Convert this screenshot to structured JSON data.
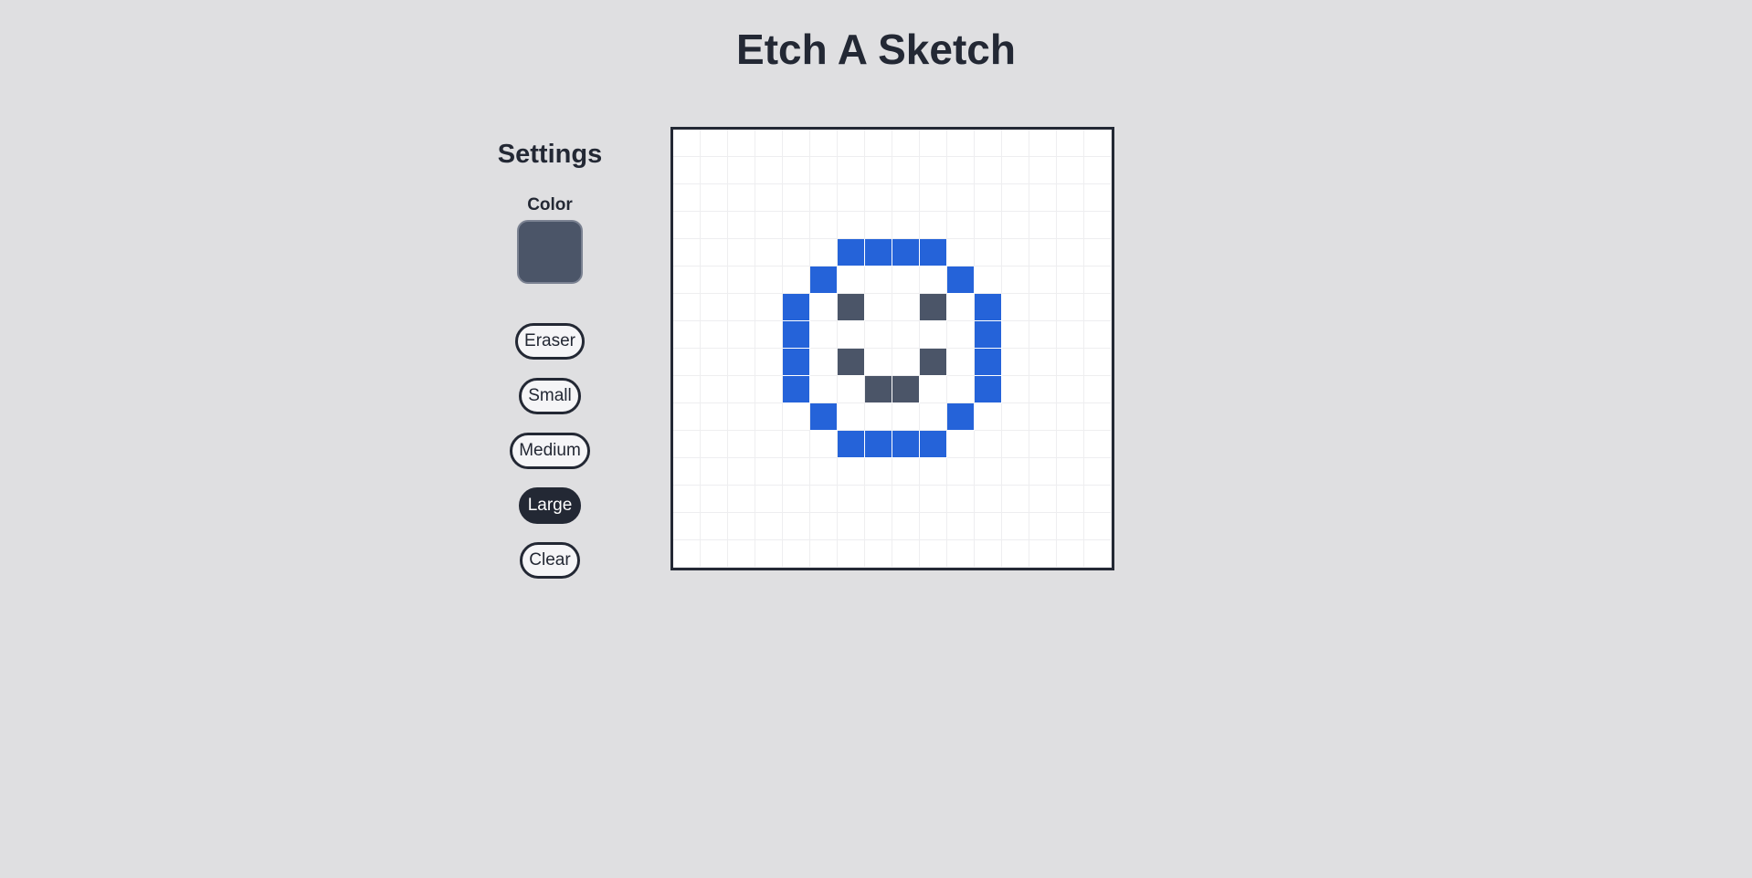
{
  "header": {
    "title": "Etch A Sketch"
  },
  "settings": {
    "title": "Settings",
    "color_label": "Color",
    "selected_color": "#4b5568",
    "buttons": [
      {
        "label": "Eraser",
        "active": false
      },
      {
        "label": "Small",
        "active": false
      },
      {
        "label": "Medium",
        "active": false
      },
      {
        "label": "Large",
        "active": true
      },
      {
        "label": "Clear",
        "active": false
      }
    ]
  },
  "board": {
    "rows": 16,
    "cols": 16,
    "empty_color": "#ffffff",
    "palette": {
      "1": "#2563d9",
      "2": "#4b5568"
    },
    "cells": [
      "0000000000000000",
      "0000000000000000",
      "0000000000000000",
      "0000000000000000",
      "0000001111000000",
      "0000010000100000",
      "0000102002010000",
      "0000100000010000",
      "0000102002010000",
      "0000100220010000",
      "0000010000100000",
      "0000001111000000",
      "0000000000000000",
      "0000000000000000",
      "0000000000000000",
      "0000000000000000"
    ]
  }
}
